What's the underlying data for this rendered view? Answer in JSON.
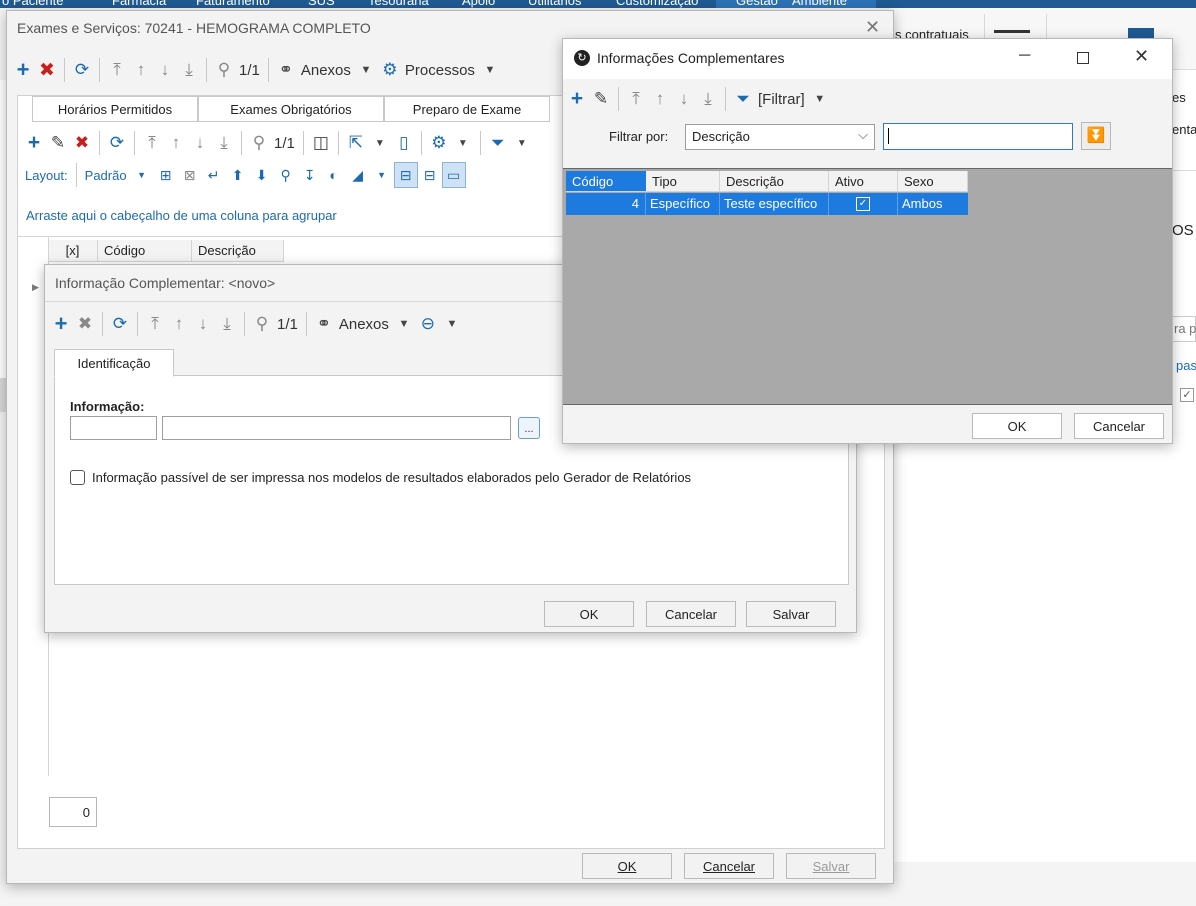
{
  "menubar": {
    "items": [
      "o Paciente",
      "Farmácia",
      "Faturamento",
      "SUS",
      "Tesouraria",
      "Apoio",
      "Utilitários",
      "Customização",
      "Gestão",
      "Ambiente"
    ]
  },
  "background": {
    "right_texts": [
      "s contratuais",
      "es",
      "enta",
      "OS",
      "ra p",
      "pas"
    ]
  },
  "main_window": {
    "title": "Exames e Serviços: 70241 - HEMOGRAMA COMPLETO",
    "toolbar": {
      "count": "1/1",
      "attachments": "Anexos",
      "processes": "Processos"
    },
    "tabs": [
      "Horários Permitidos",
      "Exames Obrigatórios",
      "Preparo de Exame"
    ],
    "toolbar2": {
      "count": "1/1"
    },
    "layout_label": "Layout:",
    "layout_value": "Padrão",
    "group_hint": "Arraste aqui o cabeçalho de uma coluna para agrupar",
    "grid_headers": [
      "[x]",
      "Código",
      "Descrição"
    ],
    "counter": "0",
    "buttons": {
      "ok": "OK",
      "cancel": "Cancelar",
      "save": "Salvar"
    }
  },
  "info_window": {
    "title": "Informação Complementar: <novo>",
    "toolbar": {
      "count": "1/1",
      "attachments": "Anexos"
    },
    "tab": "Identificação",
    "field_label": "Informação",
    "field_colon": ":",
    "browse": "...",
    "checkbox_label": "Informação passível de ser impressa nos modelos de resultados elaborados pelo Gerador de Relatórios",
    "buttons": {
      "ok": "OK",
      "cancel": "Cancelar",
      "save": "Salvar"
    }
  },
  "lookup_dialog": {
    "title": "Informações Complementares",
    "filter_button": "[Filtrar]",
    "filter_label": "Filtrar por:",
    "filter_field": "Descrição",
    "search_value": "",
    "columns": [
      "Código",
      "Tipo",
      "Descrição",
      "Ativo",
      "Sexo"
    ],
    "rows": [
      {
        "codigo": "4",
        "tipo": "Específico",
        "descricao": "Teste específico",
        "ativo": true,
        "sexo": "Ambos"
      }
    ],
    "buttons": {
      "ok": "OK",
      "cancel": "Cancelar"
    }
  }
}
